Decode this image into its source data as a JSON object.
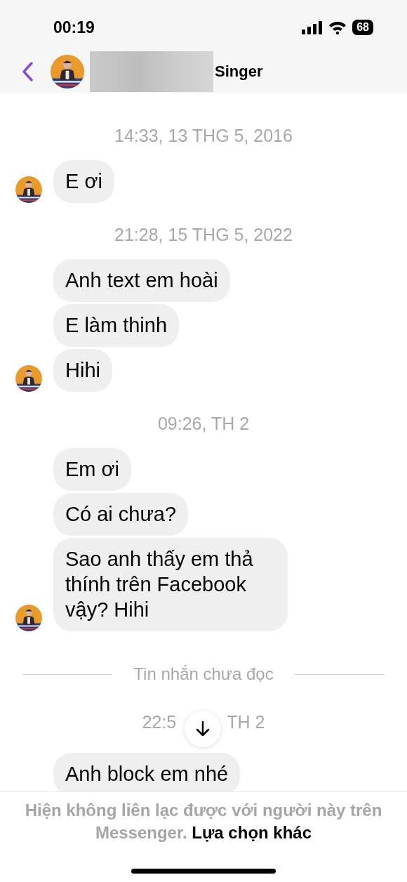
{
  "status_bar": {
    "time": "00:19",
    "battery": "68"
  },
  "header": {
    "name": "Singer"
  },
  "groups": [
    {
      "timestamp": "14:33, 13 THG 5, 2016",
      "messages": [
        "E ơi"
      ]
    },
    {
      "timestamp": "21:28, 15 THG 5, 2022",
      "messages": [
        "Anh text em hoài",
        "E làm thinh",
        "Hihi"
      ]
    },
    {
      "timestamp": "09:26, TH 2",
      "messages": [
        "Em ơi",
        "Có ai chưa?",
        "Sao anh thấy em thả thính trên Facebook vậy? Hihi"
      ]
    }
  ],
  "unread_divider": "Tin nhắn chưa đọc",
  "last_group": {
    "timestamp_parts": [
      "22:5",
      "TH 2"
    ],
    "messages": [
      "Anh block em nhé"
    ]
  },
  "footer": {
    "notice": "Hiện không liên lạc được với người này trên Messenger.",
    "link": "Lựa chọn khác"
  }
}
